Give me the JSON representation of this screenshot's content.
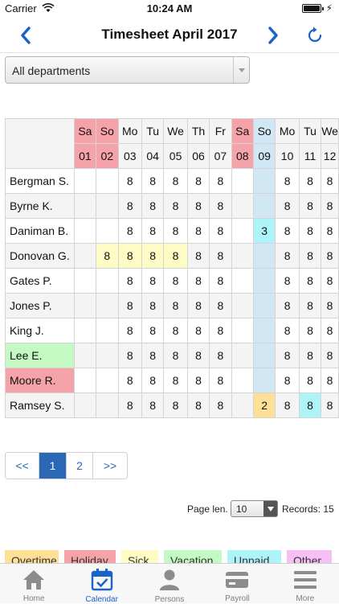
{
  "status": {
    "carrier": "Carrier",
    "time": "10:24 AM"
  },
  "nav": {
    "title": "Timesheet April 2017"
  },
  "department": {
    "selected": "All departments"
  },
  "colors": {
    "accent": "#1a63c9",
    "weekend": "#f5a3a8",
    "today_column": "#d1e7f3",
    "overtime": "#fde096",
    "holiday": "#f5a3a8",
    "sick": "#fefcc4",
    "vacation": "#c5f9c4",
    "unpaid": "#aef3f8",
    "other": "#f7c0f5"
  },
  "days": [
    {
      "dow": "Sa",
      "day": "01",
      "weekend": true
    },
    {
      "dow": "So",
      "day": "02",
      "weekend": true
    },
    {
      "dow": "Mo",
      "day": "03",
      "weekend": false
    },
    {
      "dow": "Tu",
      "day": "04",
      "weekend": false
    },
    {
      "dow": "We",
      "day": "05",
      "weekend": false
    },
    {
      "dow": "Th",
      "day": "06",
      "weekend": false
    },
    {
      "dow": "Fr",
      "day": "07",
      "weekend": false
    },
    {
      "dow": "Sa",
      "day": "08",
      "weekend": true
    },
    {
      "dow": "So",
      "day": "09",
      "weekend": false,
      "highlight": true
    },
    {
      "dow": "Mo",
      "day": "10",
      "weekend": false
    },
    {
      "dow": "Tu",
      "day": "11",
      "weekend": false
    },
    {
      "dow": "We",
      "day": "12",
      "weekend": false
    }
  ],
  "rows": [
    {
      "name": "Bergman S.",
      "values": [
        "",
        "",
        "8",
        "8",
        "8",
        "8",
        "8",
        "",
        "",
        "8",
        "8",
        "8"
      ]
    },
    {
      "name": "Byrne K.",
      "values": [
        "",
        "",
        "8",
        "8",
        "8",
        "8",
        "8",
        "",
        "",
        "8",
        "8",
        "8"
      ]
    },
    {
      "name": "Daniman B.",
      "values": [
        "",
        "",
        "8",
        "8",
        "8",
        "8",
        "8",
        "",
        "3",
        "8",
        "8",
        "8"
      ],
      "marks": {
        "8": "unpaid"
      }
    },
    {
      "name": "Donovan G.",
      "values": [
        "",
        "8",
        "8",
        "8",
        "8",
        "8",
        "8",
        "",
        "",
        "8",
        "8",
        "8"
      ],
      "marks": {
        "1": "sick",
        "2": "sick",
        "3": "sick",
        "4": "sick"
      }
    },
    {
      "name": "Gates P.",
      "values": [
        "",
        "",
        "8",
        "8",
        "8",
        "8",
        "8",
        "",
        "",
        "8",
        "8",
        "8"
      ]
    },
    {
      "name": "Jones P.",
      "values": [
        "",
        "",
        "8",
        "8",
        "8",
        "8",
        "8",
        "",
        "",
        "8",
        "8",
        "8"
      ]
    },
    {
      "name": "King J.",
      "values": [
        "",
        "",
        "8",
        "8",
        "8",
        "8",
        "8",
        "",
        "",
        "8",
        "8",
        "8"
      ]
    },
    {
      "name": "Lee E.",
      "values": [
        "",
        "",
        "8",
        "8",
        "8",
        "8",
        "8",
        "",
        "",
        "8",
        "8",
        "8"
      ],
      "name_mark": "vacation"
    },
    {
      "name": "Moore R.",
      "values": [
        "",
        "",
        "8",
        "8",
        "8",
        "8",
        "8",
        "",
        "",
        "8",
        "8",
        "8"
      ],
      "name_mark": "holiday"
    },
    {
      "name": "Ramsey S.",
      "values": [
        "",
        "",
        "8",
        "8",
        "8",
        "8",
        "8",
        "",
        "2",
        "8",
        "8",
        "8"
      ],
      "marks": {
        "8": "overtime",
        "10": "unpaid"
      }
    }
  ],
  "pagination": {
    "prev": "<<",
    "pages": [
      "1",
      "2"
    ],
    "active": "1",
    "next": ">>"
  },
  "page_len": {
    "label": "Page len.",
    "value": "10",
    "records": "Records: 15"
  },
  "legend": [
    {
      "key": "overtime",
      "label": "Overtime"
    },
    {
      "key": "holiday",
      "label": "Holiday"
    },
    {
      "key": "sick",
      "label": "Sick"
    },
    {
      "key": "vacation",
      "label": "Vacation"
    },
    {
      "key": "unpaid",
      "label": "Unpaid"
    },
    {
      "key": "other",
      "label": "Other"
    }
  ],
  "tabs": [
    {
      "id": "home",
      "label": "Home",
      "icon": "home-icon"
    },
    {
      "id": "calendar",
      "label": "Calendar",
      "icon": "calendar-icon",
      "active": true
    },
    {
      "id": "persons",
      "label": "Persons",
      "icon": "person-icon"
    },
    {
      "id": "payroll",
      "label": "Payroll",
      "icon": "credit-card-icon"
    },
    {
      "id": "more",
      "label": "More",
      "icon": "menu-icon"
    }
  ]
}
